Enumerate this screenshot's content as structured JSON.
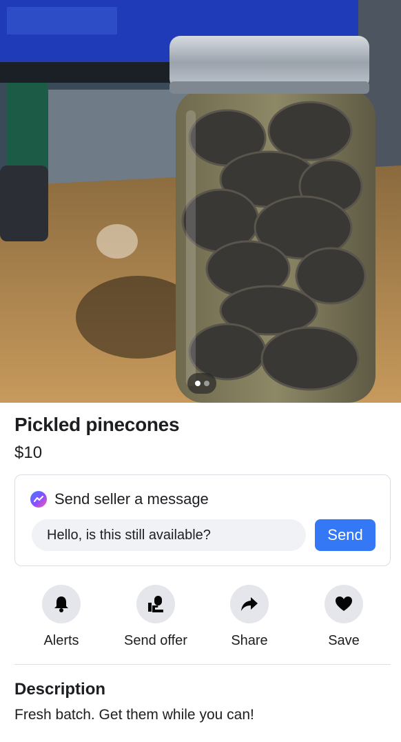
{
  "listing": {
    "title": "Pickled pinecones",
    "price": "$10",
    "photo_count": 2,
    "active_photo": 1
  },
  "message": {
    "heading": "Send seller a message",
    "input_value": "Hello, is this still available?",
    "send_label": "Send",
    "icon": "messenger-icon"
  },
  "actions": [
    {
      "label": "Alerts",
      "icon": "bell-icon"
    },
    {
      "label": "Send offer",
      "icon": "offer-icon"
    },
    {
      "label": "Share",
      "icon": "share-icon"
    },
    {
      "label": "Save",
      "icon": "heart-icon"
    }
  ],
  "description": {
    "heading": "Description",
    "text": "Fresh batch. Get them while you can!"
  },
  "colors": {
    "accent": "#3578f5",
    "icon_circle": "#e4e6eb",
    "input_bg": "#f0f2f5"
  }
}
